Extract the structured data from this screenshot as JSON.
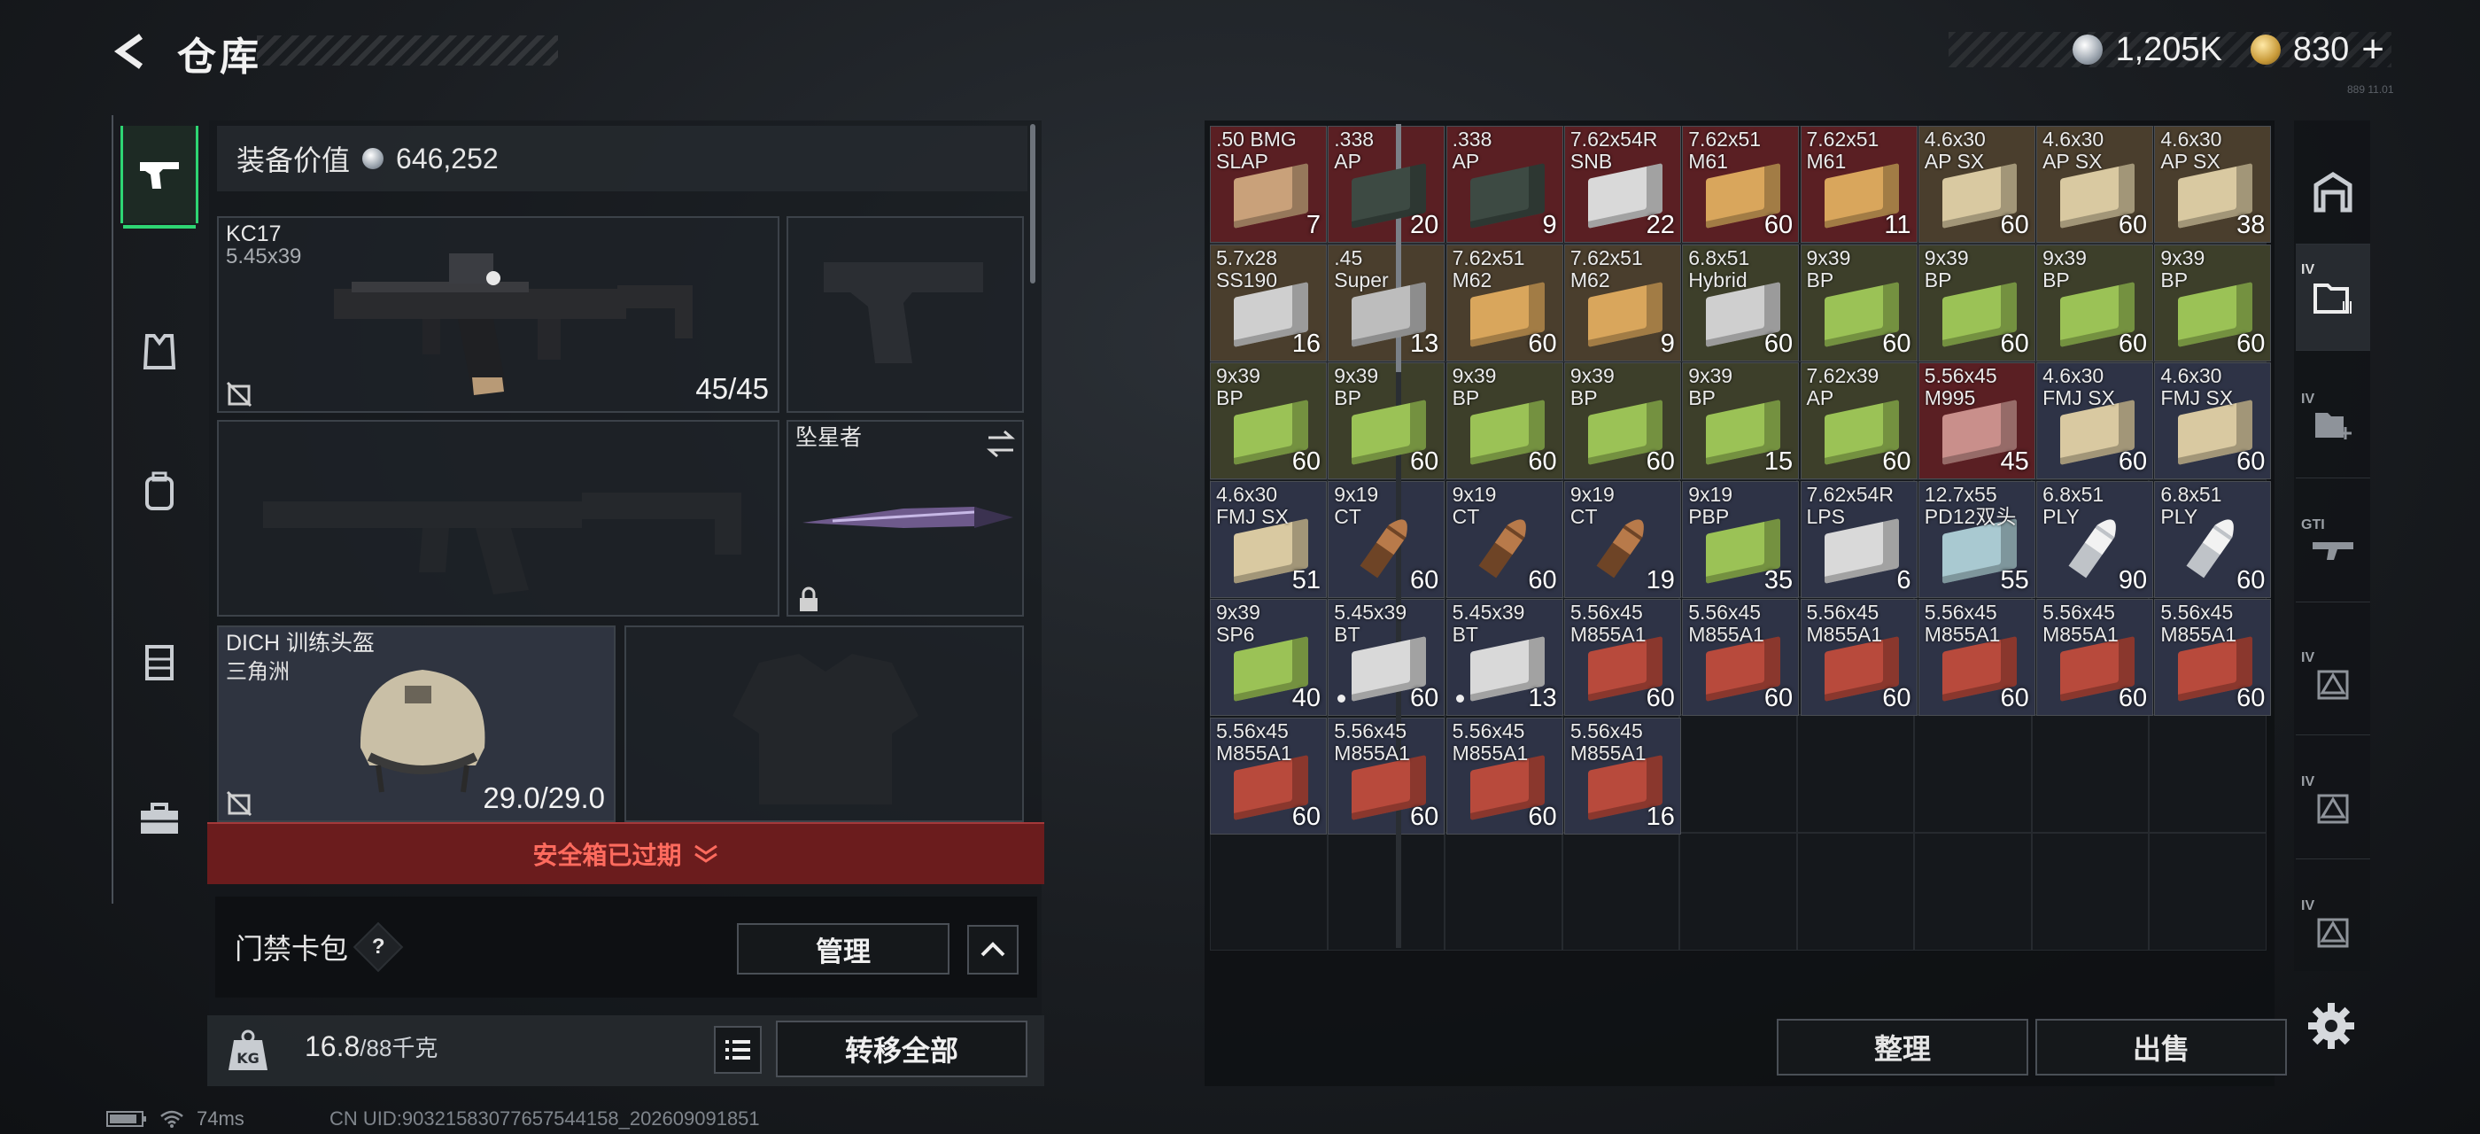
{
  "header": {
    "title": "仓库",
    "currency_silver": "1,205K",
    "currency_gold": "830",
    "gold_plus": "+",
    "corner_text": "889 11.01"
  },
  "loadout": {
    "equipment_value_label": "装备价值",
    "equipment_value": "646,252",
    "primary": {
      "name": "KC17",
      "caliber": "5.45x39",
      "ammo": "45/45"
    },
    "melee": {
      "name": "坠星者"
    },
    "helmet": {
      "name": "DICH 训练头盔",
      "subtitle": "三角洲",
      "durability": "29.0/29.0"
    },
    "safebox_expired": "安全箱已过期",
    "keycard": {
      "label": "门禁卡包",
      "help": "?",
      "manage": "管理"
    },
    "weight": {
      "current": "16.8",
      "max_unit": "/88千克"
    },
    "transfer_all": "转移全部"
  },
  "status": {
    "ping": "74ms",
    "uid": "CN UID:9032158307765754415​8_202609091851"
  },
  "stash": {
    "items": [
      {
        "l1": ".50 BMG",
        "l2": "SLAP",
        "q": "7",
        "c": "red",
        "box": "#c9a17a"
      },
      {
        "l1": ".338",
        "l2": "AP",
        "q": "20",
        "c": "red",
        "box": "#3d4a43"
      },
      {
        "l1": ".338",
        "l2": "AP",
        "q": "9",
        "c": "red",
        "box": "#3d4a43"
      },
      {
        "l1": "7.62x54R",
        "l2": "SNB",
        "q": "22",
        "c": "red",
        "box": "#d9d9d9"
      },
      {
        "l1": "7.62x51",
        "l2": "M61",
        "q": "60",
        "c": "red",
        "box": "#d9a65c"
      },
      {
        "l1": "7.62x51",
        "l2": "M61",
        "q": "11",
        "c": "red",
        "box": "#d9a65c"
      },
      {
        "l1": "4.6x30",
        "l2": "AP SX",
        "q": "60",
        "c": "brown",
        "box": "#d9c9a1"
      },
      {
        "l1": "4.6x30",
        "l2": "AP SX",
        "q": "60",
        "c": "brown",
        "box": "#d9c9a1"
      },
      {
        "l1": "4.6x30",
        "l2": "AP SX",
        "q": "38",
        "c": "brown",
        "box": "#d9c9a1"
      },
      {
        "l1": "5.7x28",
        "l2": "SS190",
        "q": "16",
        "c": "brown",
        "box": "#cfcfcf"
      },
      {
        "l1": ".45",
        "l2": "Super",
        "q": "13",
        "c": "brown",
        "box": "#bdbdbd"
      },
      {
        "l1": "7.62x51",
        "l2": "M62",
        "q": "60",
        "c": "brown",
        "box": "#d9a65c"
      },
      {
        "l1": "7.62x51",
        "l2": "M62",
        "q": "9",
        "c": "brown",
        "box": "#d9a65c"
      },
      {
        "l1": "6.8x51",
        "l2": "Hybrid",
        "q": "60",
        "c": "olive",
        "box": "#cfcfcf"
      },
      {
        "l1": "9x39",
        "l2": "BP",
        "q": "60",
        "c": "olive",
        "box": "#9bc256"
      },
      {
        "l1": "9x39",
        "l2": "BP",
        "q": "60",
        "c": "olive",
        "box": "#9bc256"
      },
      {
        "l1": "9x39",
        "l2": "BP",
        "q": "60",
        "c": "olive",
        "box": "#9bc256"
      },
      {
        "l1": "9x39",
        "l2": "BP",
        "q": "60",
        "c": "olive",
        "box": "#9bc256"
      },
      {
        "l1": "9x39",
        "l2": "BP",
        "q": "60",
        "c": "olive",
        "box": "#9bc256"
      },
      {
        "l1": "9x39",
        "l2": "BP",
        "q": "60",
        "c": "olive",
        "box": "#9bc256"
      },
      {
        "l1": "9x39",
        "l2": "BP",
        "q": "60",
        "c": "olive",
        "box": "#9bc256"
      },
      {
        "l1": "9x39",
        "l2": "BP",
        "q": "60",
        "c": "olive",
        "box": "#9bc256"
      },
      {
        "l1": "9x39",
        "l2": "BP",
        "q": "15",
        "c": "olive",
        "box": "#9bc256"
      },
      {
        "l1": "7.62x39",
        "l2": "AP",
        "q": "60",
        "c": "olive",
        "box": "#9bc256"
      },
      {
        "l1": "5.56x45",
        "l2": "M995",
        "q": "45",
        "c": "red",
        "box": "#c98f8b"
      },
      {
        "l1": "4.6x30",
        "l2": "FMJ SX",
        "q": "60",
        "c": "navy",
        "box": "#d9c9a1"
      },
      {
        "l1": "4.6x30",
        "l2": "FMJ SX",
        "q": "60",
        "c": "navy",
        "box": "#d9c9a1"
      },
      {
        "l1": "4.6x30",
        "l2": "FMJ SX",
        "q": "51",
        "c": "navy",
        "box": "#d9c9a1"
      },
      {
        "l1": "9x19",
        "l2": "CT",
        "q": "60",
        "c": "navy",
        "bullet": "copper"
      },
      {
        "l1": "9x19",
        "l2": "CT",
        "q": "60",
        "c": "navy",
        "bullet": "copper"
      },
      {
        "l1": "9x19",
        "l2": "CT",
        "q": "19",
        "c": "navy",
        "bullet": "copper"
      },
      {
        "l1": "9x19",
        "l2": "PBP",
        "q": "35",
        "c": "navy",
        "box": "#9bc256"
      },
      {
        "l1": "7.62x54R",
        "l2": "LPS",
        "q": "6",
        "c": "navy",
        "box": "#d9d9d9"
      },
      {
        "l1": "12.7x55",
        "l2": "PD12双头",
        "q": "55",
        "c": "navy",
        "box": "#a9c9d1"
      },
      {
        "l1": "6.8x51",
        "l2": "PLY",
        "q": "90",
        "c": "navy",
        "bullet": "white"
      },
      {
        "l1": "6.8x51",
        "l2": "PLY",
        "q": "60",
        "c": "navy",
        "bullet": "white"
      },
      {
        "l1": "9x39",
        "l2": "SP6",
        "q": "40",
        "c": "navy",
        "box": "#9bc256"
      },
      {
        "l1": "5.45x39",
        "l2": "BT",
        "q": "60",
        "c": "navy",
        "box": "#d9d9d9",
        "dot": true
      },
      {
        "l1": "5.45x39",
        "l2": "BT",
        "q": "13",
        "c": "navy",
        "box": "#d9d9d9",
        "dot": true
      },
      {
        "l1": "5.56x45",
        "l2": "M855A1",
        "q": "60",
        "c": "navy",
        "box": "#b84a3c"
      },
      {
        "l1": "5.56x45",
        "l2": "M855A1",
        "q": "60",
        "c": "navy",
        "box": "#b84a3c"
      },
      {
        "l1": "5.56x45",
        "l2": "M855A1",
        "q": "60",
        "c": "navy",
        "box": "#b84a3c"
      },
      {
        "l1": "5.56x45",
        "l2": "M855A1",
        "q": "60",
        "c": "navy",
        "box": "#b84a3c"
      },
      {
        "l1": "5.56x45",
        "l2": "M855A1",
        "q": "60",
        "c": "navy",
        "box": "#b84a3c"
      },
      {
        "l1": "5.56x45",
        "l2": "M855A1",
        "q": "60",
        "c": "navy",
        "box": "#b84a3c"
      },
      {
        "l1": "5.56x45",
        "l2": "M855A1",
        "q": "60",
        "c": "navy",
        "box": "#b84a3c"
      },
      {
        "l1": "5.56x45",
        "l2": "M855A1",
        "q": "60",
        "c": "navy",
        "box": "#b84a3c"
      },
      {
        "l1": "5.56x45",
        "l2": "M855A1",
        "q": "60",
        "c": "navy",
        "box": "#b84a3c"
      },
      {
        "l1": "5.56x45",
        "l2": "M855A1",
        "q": "16",
        "c": "navy",
        "box": "#b84a3c"
      }
    ],
    "sort": "整理",
    "sell": "出售"
  },
  "filters": [
    "IV",
    "IV",
    "GTI",
    "IV",
    "IV",
    "IV"
  ]
}
